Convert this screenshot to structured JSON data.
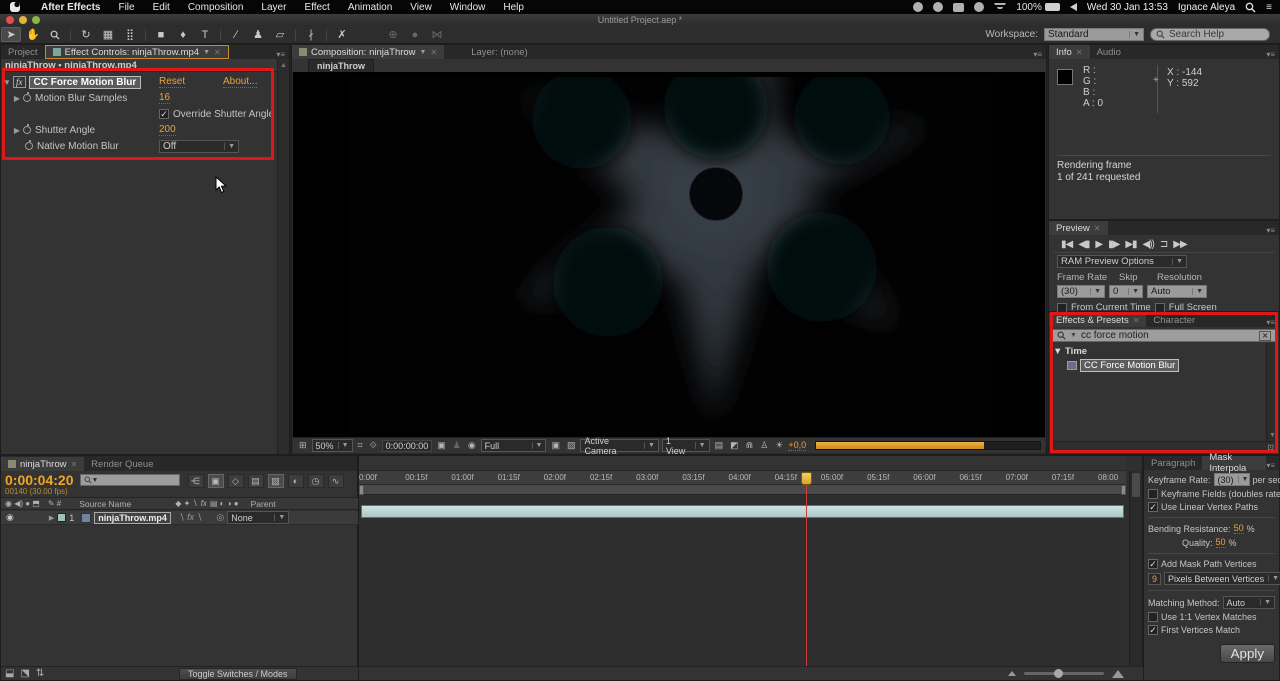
{
  "colors": {
    "accent_orange": "#e8a33d",
    "annotation_red": "#de1717",
    "layer_teal": "#b9d6d4"
  },
  "menu_bar": {
    "items": [
      "After Effects",
      "File",
      "Edit",
      "Composition",
      "Layer",
      "Effect",
      "Animation",
      "View",
      "Window",
      "Help"
    ],
    "battery": "100%",
    "clock": "Wed 30 Jan 13:53",
    "user": "Ignace Aleya"
  },
  "title_bar": {
    "title": "Untitled Project.aep *"
  },
  "workspace": {
    "label": "Workspace:",
    "value": "Standard",
    "search_placeholder": "Search Help"
  },
  "effect_controls": {
    "tab_project": "Project",
    "tab_self": "Effect Controls: ninjaThrow.mp4",
    "breadcrumb": "ninjaThrow • ninjaThrow.mp4",
    "effect_name": "CC Force Motion Blur",
    "reset_label": "Reset",
    "about_label": "About...",
    "samples_label": "Motion Blur Samples",
    "samples_value": "16",
    "override_label": "Override Shutter Angle",
    "shutter_label": "Shutter Angle",
    "shutter_value": "200",
    "native_label": "Native Motion Blur",
    "native_value": "Off"
  },
  "composition": {
    "tab": "Composition: ninjaThrow",
    "layer_tab": "Layer: (none)",
    "subtab": "ninjaThrow",
    "zoom": "50%",
    "timecode": "0:00:00:00",
    "resolution": "Full",
    "camera": "Active Camera",
    "view": "1 View",
    "offset": "+0,0"
  },
  "info_panel": {
    "tab": "Info",
    "tab2": "Audio",
    "r": "R :",
    "g": "G :",
    "b": "B :",
    "a": "A : 0",
    "x": "X : -144",
    "y": "Y : 592",
    "status_line1": "Rendering frame",
    "status_line2": "1 of 241 requested"
  },
  "preview_panel": {
    "tab": "Preview",
    "ram_options": "RAM Preview Options",
    "frame_rate_label": "Frame Rate",
    "skip_label": "Skip",
    "resolution_label": "Resolution",
    "frame_rate": "(30)",
    "skip": "0",
    "resolution": "Auto",
    "from_current": "From Current Time",
    "full_screen": "Full Screen"
  },
  "effects_presets": {
    "tab": "Effects & Presets",
    "tab2": "Character",
    "search_value": "cc force motion",
    "group": "Time",
    "item": "CC Force Motion Blur"
  },
  "timeline": {
    "tab": "ninjaThrow",
    "tab2": "Render Queue",
    "timecode": "0:00:04:20",
    "frame_info": "00140 (30.00 fps)",
    "col_source": "Source Name",
    "col_parent": "Parent",
    "layer_number": "1",
    "layer_name": "ninjaThrow.mp4",
    "parent_value": "None",
    "toggle_label": "Toggle Switches / Modes",
    "ruler_ticks": [
      "0:00f",
      "00:15f",
      "01:00f",
      "01:15f",
      "02:00f",
      "02:15f",
      "03:00f",
      "03:15f",
      "04:00f",
      "04:15f",
      "05:00f",
      "05:15f",
      "06:00f",
      "06:15f",
      "07:00f",
      "07:15f",
      "08:00"
    ]
  },
  "mask_interpolation": {
    "tab": "Paragraph",
    "tab2": "Mask Interpola",
    "keyframe_rate_label": "Keyframe Rate:",
    "keyframe_rate": "(30)",
    "per_second": "per second",
    "keyframe_fields": "Keyframe Fields (doubles rate)",
    "linear_vertex": "Use Linear Vertex Paths",
    "bending_label": "Bending Resistance:",
    "bending_value": "50",
    "pct": "%",
    "quality_label": "Quality:",
    "quality_value": "50",
    "add_vertices": "Add Mask Path Vertices",
    "vertices_value": "9",
    "vertices_unit": "Pixels Between Vertices",
    "matching_label": "Matching Method:",
    "matching_value": "Auto",
    "vertex_matches": "Use 1:1 Vertex Matches",
    "first_vertices": "First Vertices Match",
    "apply": "Apply"
  }
}
